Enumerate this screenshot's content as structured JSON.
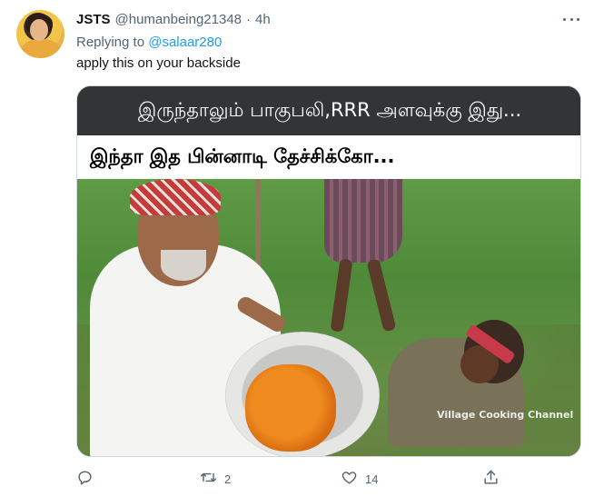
{
  "tweet": {
    "display_name": "JSTS",
    "handle": "@humanbeing21348",
    "separator": "·",
    "time": "4h",
    "replying_prefix": "Replying to",
    "replying_to": "@salaar280",
    "text": "apply this on your backside"
  },
  "meme": {
    "top_caption": "இருந்தாலும் பாகுபலி,RRR அளவுக்கு இது...",
    "bottom_caption": "இந்தா இத பின்னாடி தேச்சிக்கோ...",
    "watermark": "Village Cooking Channel"
  },
  "actions": {
    "reply_icon": "reply-icon",
    "retweet_icon": "retweet-icon",
    "retweet_count": "2",
    "like_icon": "heart-icon",
    "like_count": "14",
    "share_icon": "share-icon"
  },
  "colors": {
    "link": "#1d9bf0",
    "secondary_text": "#536471",
    "primary_text": "#0f1419",
    "border": "#cfd9de"
  }
}
